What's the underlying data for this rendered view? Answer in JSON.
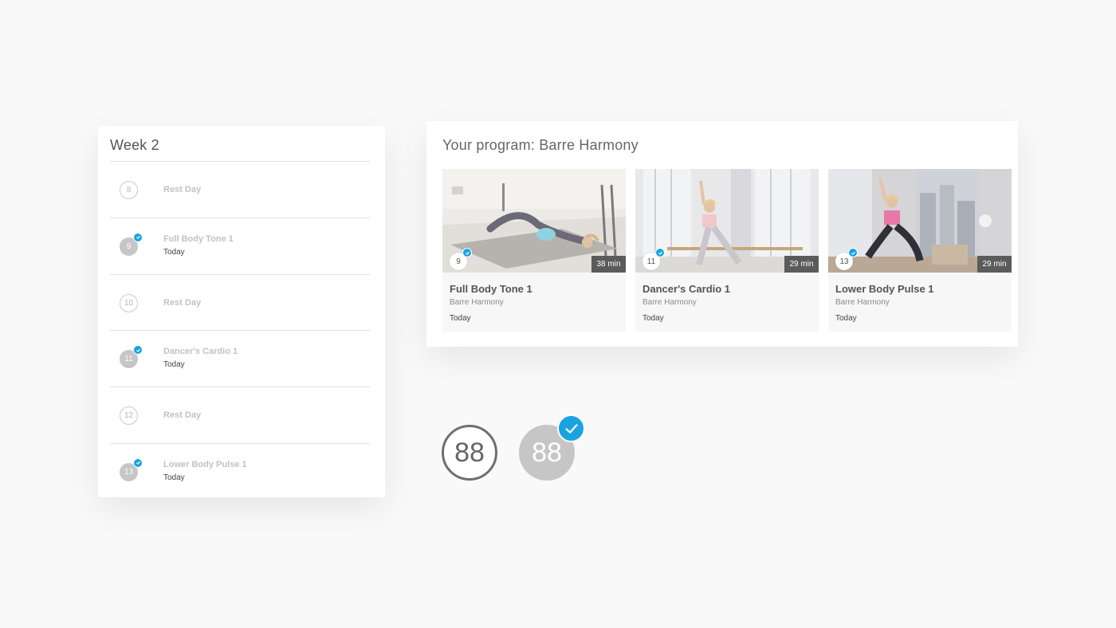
{
  "colors": {
    "accent_check": "#1aa3e0",
    "done_circle": "#c6c6c6",
    "duration_badge": "#5b5b5b"
  },
  "week": {
    "title": "Week 2",
    "days": [
      {
        "number": "8",
        "label": "Rest Day",
        "sub": "",
        "status": "rest"
      },
      {
        "number": "9",
        "label": "Full Body Tone 1",
        "sub": "Today",
        "status": "done"
      },
      {
        "number": "10",
        "label": "Rest Day",
        "sub": "",
        "status": "rest"
      },
      {
        "number": "11",
        "label": "Dancer's Cardio 1",
        "sub": "Today",
        "status": "done"
      },
      {
        "number": "12",
        "label": "Rest Day",
        "sub": "",
        "status": "rest"
      },
      {
        "number": "13",
        "label": "Lower Body Pulse 1",
        "sub": "Today",
        "status": "done"
      }
    ]
  },
  "program": {
    "title": "Your program: Barre Harmony",
    "cards": [
      {
        "number": "9",
        "duration": "38 min",
        "title": "Full Body Tone 1",
        "series": "Barre Harmony",
        "when": "Today",
        "icon": "check-icon"
      },
      {
        "number": "11",
        "duration": "29 min",
        "title": "Dancer's Cardio 1",
        "series": "Barre Harmony",
        "when": "Today",
        "icon": "check-icon"
      },
      {
        "number": "13",
        "duration": "29 min",
        "title": "Lower Body Pulse 1",
        "series": "Barre Harmony",
        "when": "Today",
        "icon": "check-icon"
      }
    ]
  },
  "badges": {
    "outline_value": "88",
    "filled_value": "88"
  }
}
